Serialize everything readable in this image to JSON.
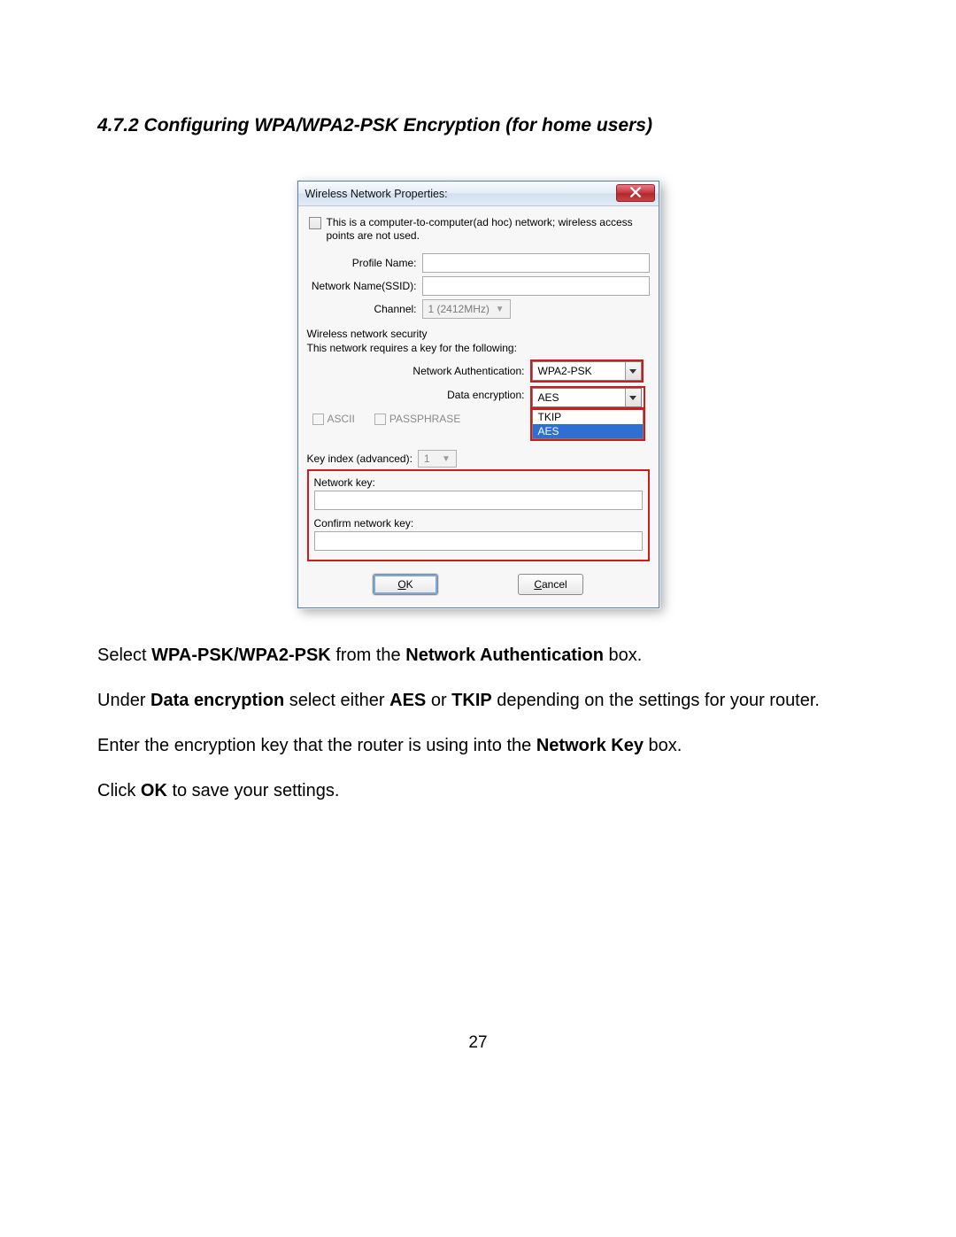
{
  "section_heading": "4.7.2 Configuring WPA/WPA2-PSK Encryption (for home users)",
  "dialog": {
    "title": "Wireless Network Properties:",
    "adhoc_text": "This is a computer-to-computer(ad hoc) network; wireless access points are not used.",
    "profile_name_label": "Profile Name:",
    "ssid_label": "Network Name(SSID):",
    "channel_label": "Channel:",
    "channel_value": "1 (2412MHz)",
    "security_title": "Wireless network security",
    "security_desc": "This network requires a key for the following:",
    "auth_label": "Network Authentication:",
    "auth_value": "WPA2-PSK",
    "enc_label": "Data encryption:",
    "enc_value": "AES",
    "enc_options": [
      "TKIP",
      "AES"
    ],
    "ascii_label": "ASCII",
    "passphrase_label": "PASSPHRASE",
    "keyidx_label": "Key index (advanced):",
    "keyidx_value": "1",
    "netkey_label": "Network key:",
    "confirmkey_label": "Confirm network key:",
    "ok_label": "OK",
    "cancel_label": "Cancel"
  },
  "instructions": {
    "p1_a": "Select ",
    "p1_b": "WPA-PSK/WPA2-PSK",
    "p1_c": " from the ",
    "p1_d": "Network Authentication",
    "p1_e": " box.",
    "p2_a": "Under ",
    "p2_b": "Data encryption",
    "p2_c": " select either ",
    "p2_d": "AES",
    "p2_e": " or ",
    "p2_f": "TKIP",
    "p2_g": " depending on the settings for your router.",
    "p3_a": "Enter the encryption key that the router is using into the ",
    "p3_b": "Network Key",
    "p3_c": " box.",
    "p4_a": "Click ",
    "p4_b": "OK",
    "p4_c": " to save your settings."
  },
  "page_number": "27"
}
